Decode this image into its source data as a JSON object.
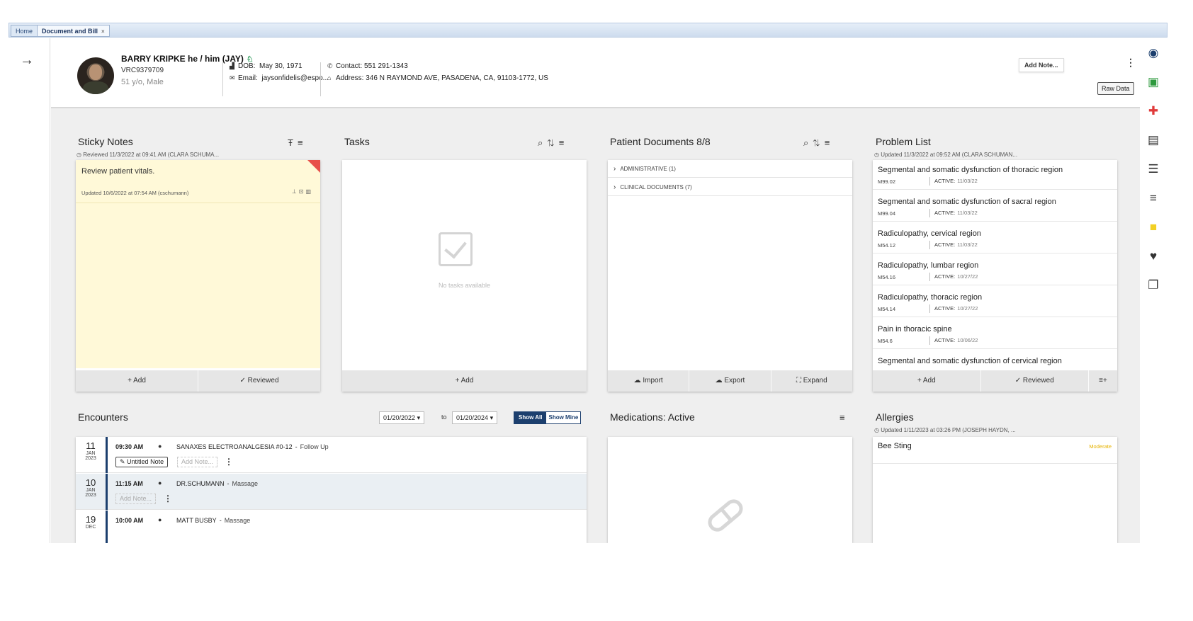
{
  "tabs": [
    {
      "label": "Home"
    },
    {
      "label": "Document and Bill"
    }
  ],
  "tab_close": "×",
  "nav": {
    "collapse_icon": "arrow-right-icon",
    "arrow_glyph": "→"
  },
  "patient": {
    "name": "BARRY KRIPKE he / him (JAY)",
    "id": "VRC9379709",
    "age_sex": "51 y/o, Male",
    "dob_label": "DOB:",
    "dob": "May 30, 1971",
    "email_label": "Email:",
    "email": "jaysonfidelis@espo...",
    "contact_label": "Contact:",
    "contact": "551 291-1343",
    "address_label": "Address:",
    "address": "346 N RAYMOND AVE, PASADENA, CA, 91103-1772, US"
  },
  "header_actions": {
    "add_note": "Add Note...",
    "raw_data": "Raw Data"
  },
  "sticky_notes": {
    "title": "Sticky Notes",
    "reviewed": "Reviewed 11/3/2022 at 09:41 AM (CLARA SCHUMA...",
    "note_text": "Review patient vitals.",
    "note_updated": "Updated 10/6/2022 at 07:54 AM (cschumann)",
    "add": "+ Add",
    "reviewed_btn": "✓ Reviewed"
  },
  "tasks": {
    "title": "Tasks",
    "empty": "No tasks available",
    "add": "+ Add"
  },
  "patient_documents": {
    "title": "Patient Documents 8/8",
    "folders": [
      {
        "label": "ADMINISTRATIVE (1)"
      },
      {
        "label": "CLINICAL DOCUMENTS (7)"
      }
    ],
    "import": "Import",
    "export": "Export",
    "expand": "Expand"
  },
  "problem_list": {
    "title": "Problem List",
    "updated": "Updated 11/3/2022 at 09:52 AM (CLARA SCHUMAN...",
    "items": [
      {
        "title": "Segmental and somatic dysfunction of thoracic region",
        "code": "M99.02",
        "status": "ACTIVE:",
        "date": "11/03/22"
      },
      {
        "title": "Segmental and somatic dysfunction of sacral region",
        "code": "M99.04",
        "status": "ACTIVE:",
        "date": "11/03/22"
      },
      {
        "title": "Radiculopathy, cervical region",
        "code": "M54.12",
        "status": "ACTIVE:",
        "date": "11/03/22"
      },
      {
        "title": "Radiculopathy, lumbar region",
        "code": "M54.16",
        "status": "ACTIVE:",
        "date": "10/27/22"
      },
      {
        "title": "Radiculopathy, thoracic region",
        "code": "M54.14",
        "status": "ACTIVE:",
        "date": "10/27/22"
      },
      {
        "title": "Pain in thoracic spine",
        "code": "M54.6",
        "status": "ACTIVE:",
        "date": "10/06/22"
      },
      {
        "title": "Segmental and somatic dysfunction of cervical region",
        "code": "",
        "status": "",
        "date": ""
      }
    ],
    "add": "+ Add",
    "reviewed_btn": "✓ Reviewed"
  },
  "encounters": {
    "title": "Encounters",
    "from_date": "01/20/2022",
    "to_label": "to",
    "to_date": "01/20/2024",
    "show_all": "Show All",
    "show_mine": "Show Mine",
    "rows": [
      {
        "day": "11",
        "month": "JAN",
        "year": "2023",
        "time": "09:30 AM",
        "provider": "SANAXES ELECTROANALGESIA #0-12",
        "visit_type": "Follow Up",
        "note": "Untitled Note",
        "add_note": "Add Note..."
      },
      {
        "day": "10",
        "month": "JAN",
        "year": "2023",
        "time": "11:15 AM",
        "provider": "DR.SCHUMANN",
        "visit_type": "Massage",
        "note": "",
        "add_note": "Add Note..."
      },
      {
        "day": "19",
        "month": "DEC",
        "year": "",
        "time": "10:00 AM",
        "provider": "MATT BUSBY",
        "visit_type": "Massage",
        "note": "",
        "add_note": ""
      }
    ]
  },
  "medications": {
    "title": "Medications: Active"
  },
  "allergies": {
    "title": "Allergies",
    "updated": "Updated 1/11/2023 at 03:26 PM (JOSEPH HAYDN, ...",
    "items": [
      {
        "name": "Bee Sting",
        "severity": "Moderate"
      }
    ]
  },
  "right_rail_icons": [
    {
      "name": "person-circle-icon",
      "glyph": "●",
      "color": "#1c3f6e"
    },
    {
      "name": "image-gallery-icon",
      "glyph": "▣",
      "color": "#2e9a3e"
    },
    {
      "name": "medical-cross-icon",
      "glyph": "✚",
      "color": "#e03a3a"
    },
    {
      "name": "clipboard-icon",
      "glyph": "▤",
      "color": "#333333"
    },
    {
      "name": "list-icon",
      "glyph": "☰",
      "color": "#333333"
    },
    {
      "name": "playlist-add-icon",
      "glyph": "≡",
      "color": "#333333"
    },
    {
      "name": "sticky-note-icon",
      "glyph": "■",
      "color": "#f2d024"
    },
    {
      "name": "heart-icon",
      "glyph": "♥",
      "color": "#333333"
    },
    {
      "name": "library-icon",
      "glyph": "❐",
      "color": "#333333"
    }
  ]
}
